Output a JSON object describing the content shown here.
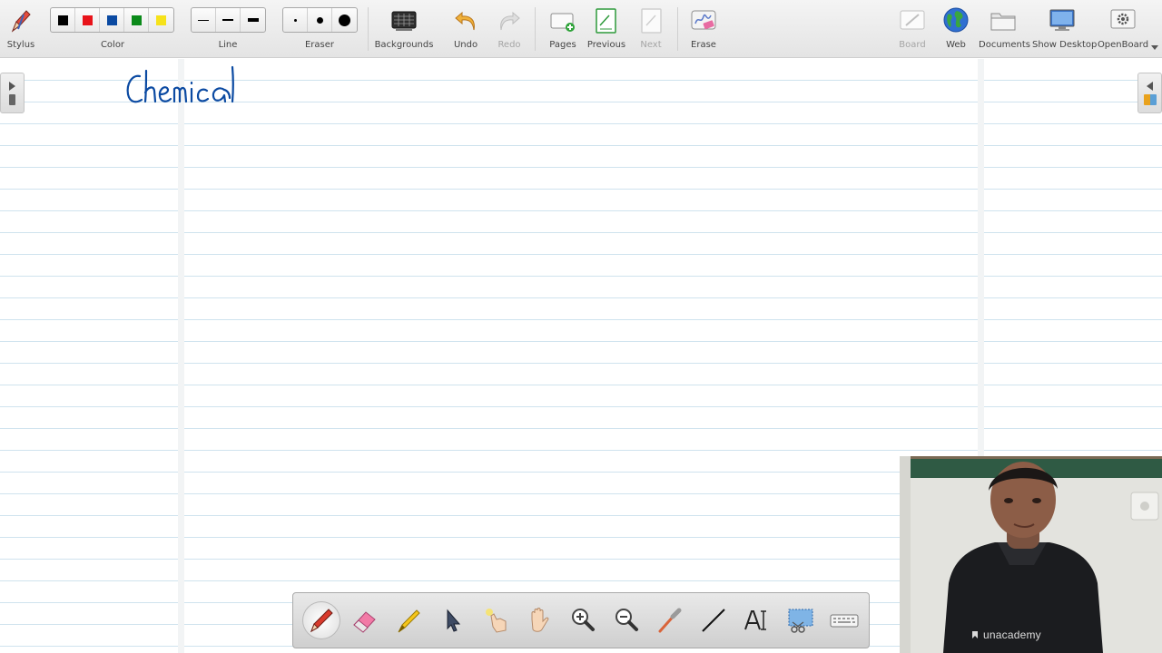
{
  "toolbar": {
    "stylus": {
      "label": "Stylus",
      "icon": "stylus-pen-icon"
    },
    "color": {
      "label": "Color",
      "swatches": [
        "#000000",
        "#e8131a",
        "#0b4aa2",
        "#0b8a1a",
        "#f6e21a"
      ]
    },
    "line": {
      "label": "Line"
    },
    "eraser": {
      "label": "Eraser"
    },
    "backgrounds": {
      "label": "Backgrounds"
    },
    "undo": {
      "label": "Undo"
    },
    "redo": {
      "label": "Redo",
      "disabled": true
    },
    "pages": {
      "label": "Pages"
    },
    "previous": {
      "label": "Previous"
    },
    "next": {
      "label": "Next",
      "disabled": true
    },
    "erase": {
      "label": "Erase"
    },
    "board": {
      "label": "Board",
      "disabled": true
    },
    "web": {
      "label": "Web"
    },
    "documents": {
      "label": "Documents"
    },
    "show_desktop": {
      "label": "Show Desktop"
    },
    "openboard": {
      "label": "OpenBoard"
    }
  },
  "board": {
    "background": "lined",
    "line_color": "#cfe3ee",
    "handwriting_text": "Chemical",
    "ink_color": "#0b4aa2"
  },
  "palette": {
    "tools": [
      "pen",
      "eraser",
      "highlighter",
      "pointer",
      "laser-pointer",
      "hand",
      "zoom-in",
      "zoom-out",
      "line",
      "text",
      "capture",
      "keyboard"
    ],
    "active": "pen"
  },
  "webcam": {
    "shirt_logo_text": "unacademy"
  }
}
